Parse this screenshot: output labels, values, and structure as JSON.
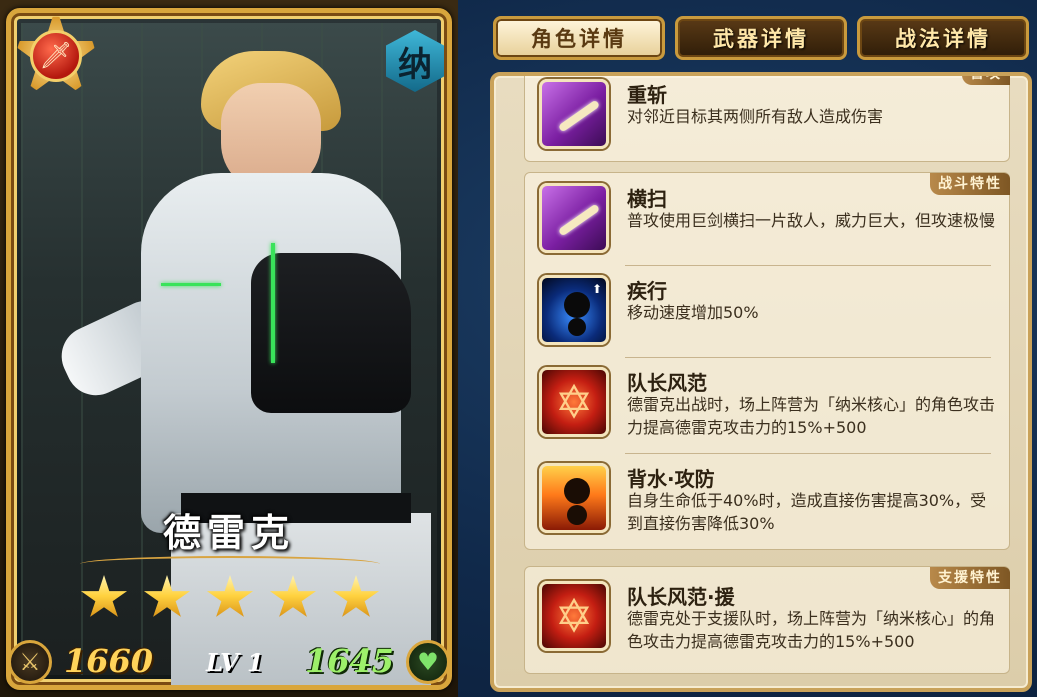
{
  "card": {
    "name": "德雷克",
    "faction_char": "纳",
    "stars": 5,
    "attack": "1660",
    "level": "LV 1",
    "hp": "1645",
    "class_icon": "sword-emblem-icon",
    "colors": {
      "frame_gold": "#d9a63c",
      "attack": "#ffd35a",
      "hp": "#9df06a",
      "faction": "#3fb7d8"
    }
  },
  "tabs": [
    {
      "label": "角色详情",
      "active": true
    },
    {
      "label": "武器详情",
      "active": false
    },
    {
      "label": "战法详情",
      "active": false
    }
  ],
  "groups": {
    "top": {
      "tag": "普攻",
      "skills": [
        {
          "name": "重斩",
          "desc": "对邻近目标其两侧所有敌人造成伤害",
          "icon": "slash-icon"
        }
      ]
    },
    "combat": {
      "tag": "战斗特性",
      "skills": [
        {
          "name": "横扫",
          "desc": "普攻使用巨剑横扫一片敌人，威力巨大，但攻速极慢",
          "icon": "slash-icon"
        },
        {
          "name": "疾行",
          "desc": "移动速度增加50%",
          "icon": "sprint-icon"
        },
        {
          "name": "队长风范",
          "desc": "德雷克出战时，场上阵营为「纳米核心」的角色攻击力提高德雷克攻击力的15%+500",
          "icon": "hexagram-seal-icon"
        },
        {
          "name": "背水·攻防",
          "desc": "自身生命低于40%时，造成直接伤害提高30%，受到直接伤害降低30%",
          "icon": "flame-figure-icon"
        }
      ]
    },
    "support": {
      "tag": "支援特性",
      "skills": [
        {
          "name": "队长风范·援",
          "desc": "德雷克处于支援队时，场上阵营为「纳米核心」的角色攻击力提高德雷克攻击力的15%+500",
          "icon": "hexagram-seal-icon"
        }
      ]
    }
  }
}
